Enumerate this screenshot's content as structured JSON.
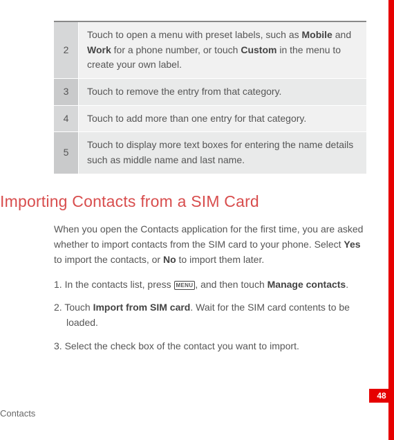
{
  "table": {
    "rows": [
      {
        "num": "2",
        "parts": [
          "Touch to open a menu with preset labels, such as ",
          "Mobile",
          " and ",
          "Work",
          " for a phone number, or touch ",
          "Custom",
          " in the menu to create your own label."
        ]
      },
      {
        "num": "3",
        "parts": [
          "Touch to remove the entry from that category."
        ]
      },
      {
        "num": "4",
        "parts": [
          "Touch to add more than one entry for that category."
        ]
      },
      {
        "num": "5",
        "parts": [
          "Touch to display more text boxes for entering the name details such as middle name and last name."
        ]
      }
    ]
  },
  "heading": "Importing Contacts from a SIM Card",
  "intro": {
    "parts": [
      "When you open the Contacts application for the first time, you are asked whether to import contacts from the SIM card to your phone. Select ",
      "Yes",
      " to import the contacts, or ",
      "No",
      " to import them later."
    ]
  },
  "steps": [
    {
      "num": "1.",
      "parts": [
        "In the contacts list, press ",
        {
          "key": "MENU"
        },
        ", and then touch ",
        "Manage contacts",
        "."
      ]
    },
    {
      "num": "2.",
      "parts": [
        "Touch ",
        "Import from SIM card",
        ". Wait for the SIM card contents to be loaded."
      ]
    },
    {
      "num": "3.",
      "parts": [
        "Select the check box of the contact you want to import."
      ]
    }
  ],
  "footer_chapter": "Contacts",
  "page_number": "48"
}
